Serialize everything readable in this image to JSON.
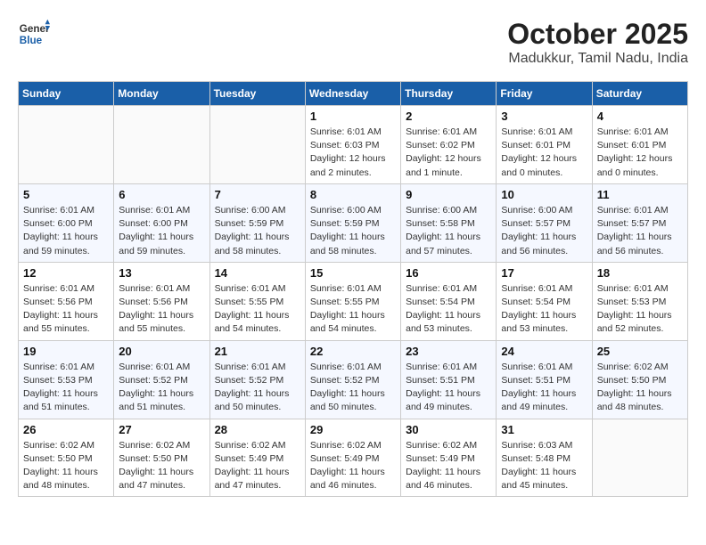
{
  "header": {
    "logo_line1": "General",
    "logo_line2": "Blue",
    "month": "October 2025",
    "location": "Madukkur, Tamil Nadu, India"
  },
  "weekdays": [
    "Sunday",
    "Monday",
    "Tuesday",
    "Wednesday",
    "Thursday",
    "Friday",
    "Saturday"
  ],
  "weeks": [
    [
      {
        "day": "",
        "sunrise": "",
        "sunset": "",
        "daylight": ""
      },
      {
        "day": "",
        "sunrise": "",
        "sunset": "",
        "daylight": ""
      },
      {
        "day": "",
        "sunrise": "",
        "sunset": "",
        "daylight": ""
      },
      {
        "day": "1",
        "sunrise": "Sunrise: 6:01 AM",
        "sunset": "Sunset: 6:03 PM",
        "daylight": "Daylight: 12 hours and 2 minutes."
      },
      {
        "day": "2",
        "sunrise": "Sunrise: 6:01 AM",
        "sunset": "Sunset: 6:02 PM",
        "daylight": "Daylight: 12 hours and 1 minute."
      },
      {
        "day": "3",
        "sunrise": "Sunrise: 6:01 AM",
        "sunset": "Sunset: 6:01 PM",
        "daylight": "Daylight: 12 hours and 0 minutes."
      },
      {
        "day": "4",
        "sunrise": "Sunrise: 6:01 AM",
        "sunset": "Sunset: 6:01 PM",
        "daylight": "Daylight: 12 hours and 0 minutes."
      }
    ],
    [
      {
        "day": "5",
        "sunrise": "Sunrise: 6:01 AM",
        "sunset": "Sunset: 6:00 PM",
        "daylight": "Daylight: 11 hours and 59 minutes."
      },
      {
        "day": "6",
        "sunrise": "Sunrise: 6:01 AM",
        "sunset": "Sunset: 6:00 PM",
        "daylight": "Daylight: 11 hours and 59 minutes."
      },
      {
        "day": "7",
        "sunrise": "Sunrise: 6:00 AM",
        "sunset": "Sunset: 5:59 PM",
        "daylight": "Daylight: 11 hours and 58 minutes."
      },
      {
        "day": "8",
        "sunrise": "Sunrise: 6:00 AM",
        "sunset": "Sunset: 5:59 PM",
        "daylight": "Daylight: 11 hours and 58 minutes."
      },
      {
        "day": "9",
        "sunrise": "Sunrise: 6:00 AM",
        "sunset": "Sunset: 5:58 PM",
        "daylight": "Daylight: 11 hours and 57 minutes."
      },
      {
        "day": "10",
        "sunrise": "Sunrise: 6:00 AM",
        "sunset": "Sunset: 5:57 PM",
        "daylight": "Daylight: 11 hours and 56 minutes."
      },
      {
        "day": "11",
        "sunrise": "Sunrise: 6:01 AM",
        "sunset": "Sunset: 5:57 PM",
        "daylight": "Daylight: 11 hours and 56 minutes."
      }
    ],
    [
      {
        "day": "12",
        "sunrise": "Sunrise: 6:01 AM",
        "sunset": "Sunset: 5:56 PM",
        "daylight": "Daylight: 11 hours and 55 minutes."
      },
      {
        "day": "13",
        "sunrise": "Sunrise: 6:01 AM",
        "sunset": "Sunset: 5:56 PM",
        "daylight": "Daylight: 11 hours and 55 minutes."
      },
      {
        "day": "14",
        "sunrise": "Sunrise: 6:01 AM",
        "sunset": "Sunset: 5:55 PM",
        "daylight": "Daylight: 11 hours and 54 minutes."
      },
      {
        "day": "15",
        "sunrise": "Sunrise: 6:01 AM",
        "sunset": "Sunset: 5:55 PM",
        "daylight": "Daylight: 11 hours and 54 minutes."
      },
      {
        "day": "16",
        "sunrise": "Sunrise: 6:01 AM",
        "sunset": "Sunset: 5:54 PM",
        "daylight": "Daylight: 11 hours and 53 minutes."
      },
      {
        "day": "17",
        "sunrise": "Sunrise: 6:01 AM",
        "sunset": "Sunset: 5:54 PM",
        "daylight": "Daylight: 11 hours and 53 minutes."
      },
      {
        "day": "18",
        "sunrise": "Sunrise: 6:01 AM",
        "sunset": "Sunset: 5:53 PM",
        "daylight": "Daylight: 11 hours and 52 minutes."
      }
    ],
    [
      {
        "day": "19",
        "sunrise": "Sunrise: 6:01 AM",
        "sunset": "Sunset: 5:53 PM",
        "daylight": "Daylight: 11 hours and 51 minutes."
      },
      {
        "day": "20",
        "sunrise": "Sunrise: 6:01 AM",
        "sunset": "Sunset: 5:52 PM",
        "daylight": "Daylight: 11 hours and 51 minutes."
      },
      {
        "day": "21",
        "sunrise": "Sunrise: 6:01 AM",
        "sunset": "Sunset: 5:52 PM",
        "daylight": "Daylight: 11 hours and 50 minutes."
      },
      {
        "day": "22",
        "sunrise": "Sunrise: 6:01 AM",
        "sunset": "Sunset: 5:52 PM",
        "daylight": "Daylight: 11 hours and 50 minutes."
      },
      {
        "day": "23",
        "sunrise": "Sunrise: 6:01 AM",
        "sunset": "Sunset: 5:51 PM",
        "daylight": "Daylight: 11 hours and 49 minutes."
      },
      {
        "day": "24",
        "sunrise": "Sunrise: 6:01 AM",
        "sunset": "Sunset: 5:51 PM",
        "daylight": "Daylight: 11 hours and 49 minutes."
      },
      {
        "day": "25",
        "sunrise": "Sunrise: 6:02 AM",
        "sunset": "Sunset: 5:50 PM",
        "daylight": "Daylight: 11 hours and 48 minutes."
      }
    ],
    [
      {
        "day": "26",
        "sunrise": "Sunrise: 6:02 AM",
        "sunset": "Sunset: 5:50 PM",
        "daylight": "Daylight: 11 hours and 48 minutes."
      },
      {
        "day": "27",
        "sunrise": "Sunrise: 6:02 AM",
        "sunset": "Sunset: 5:50 PM",
        "daylight": "Daylight: 11 hours and 47 minutes."
      },
      {
        "day": "28",
        "sunrise": "Sunrise: 6:02 AM",
        "sunset": "Sunset: 5:49 PM",
        "daylight": "Daylight: 11 hours and 47 minutes."
      },
      {
        "day": "29",
        "sunrise": "Sunrise: 6:02 AM",
        "sunset": "Sunset: 5:49 PM",
        "daylight": "Daylight: 11 hours and 46 minutes."
      },
      {
        "day": "30",
        "sunrise": "Sunrise: 6:02 AM",
        "sunset": "Sunset: 5:49 PM",
        "daylight": "Daylight: 11 hours and 46 minutes."
      },
      {
        "day": "31",
        "sunrise": "Sunrise: 6:03 AM",
        "sunset": "Sunset: 5:48 PM",
        "daylight": "Daylight: 11 hours and 45 minutes."
      },
      {
        "day": "",
        "sunrise": "",
        "sunset": "",
        "daylight": ""
      }
    ]
  ]
}
